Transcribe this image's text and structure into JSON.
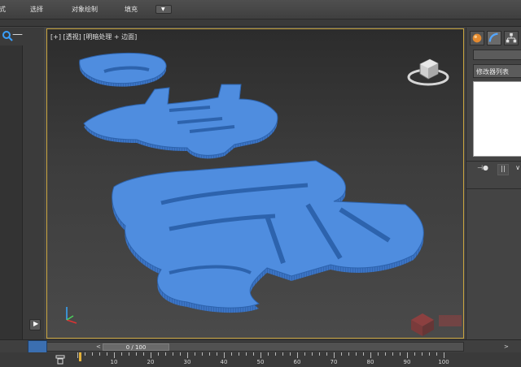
{
  "menu": {
    "items": [
      {
        "label": "式"
      },
      {
        "label": "选择"
      },
      {
        "label": "对象绘制"
      },
      {
        "label": "填充"
      }
    ]
  },
  "viewport": {
    "label": "[+] [透视] [明暗处理 + 边面]"
  },
  "command_panel": {
    "modifier_list_label": "修改器列表"
  },
  "timeline": {
    "slider_label": "0 / 100",
    "prev_label": "<",
    "next_label": ">"
  },
  "ruler": {
    "ticks": [
      "10",
      "20",
      "30",
      "40",
      "50",
      "60",
      "70",
      "80",
      "90",
      "100"
    ]
  },
  "colors": {
    "model_blue": "#4a86d6",
    "viewport_border": "#c9a53f",
    "key_blue": "#3b6fb1",
    "playhead": "#e4b23a"
  },
  "icons": {
    "search": "search-icon",
    "minus": "minus-icon",
    "play": "play-icon",
    "viewcube": "viewcube-icon",
    "axis": "axis-gizmo-icon",
    "create_tab": "sphere-icon",
    "modify_tab": "arc-icon",
    "hierarchy_tab": "hierarchy-icon",
    "pin": "pin-stack-icon",
    "show_end": "show-end-result-icon",
    "key_mode": "key-mode-icon",
    "lock": "lock-icon"
  }
}
